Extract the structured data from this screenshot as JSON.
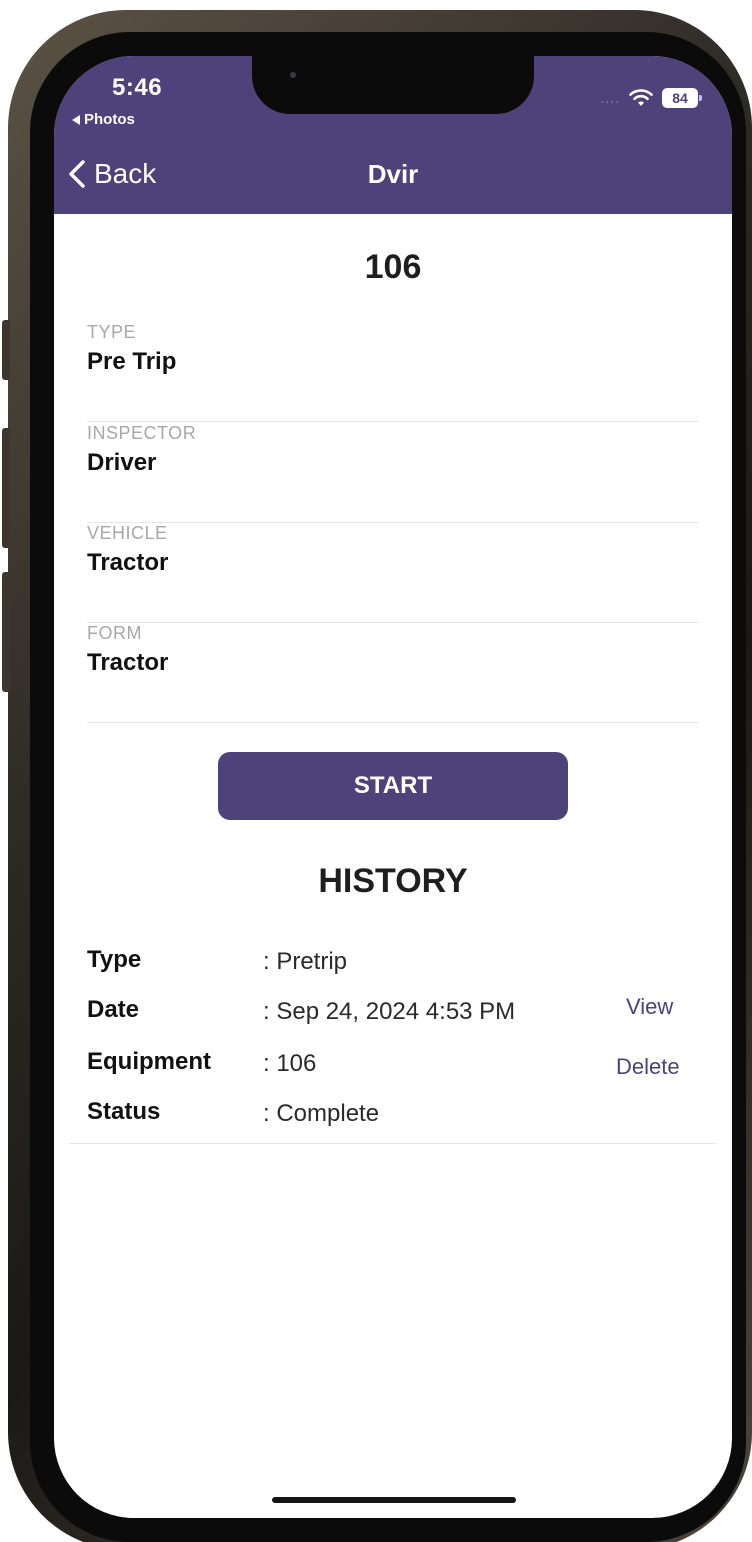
{
  "status_bar": {
    "time": "5:46",
    "back_app": "Photos",
    "battery": "84",
    "cellular_dots": "....",
    "icons": [
      "wifi-icon",
      "battery-icon"
    ]
  },
  "nav": {
    "back_label": "Back",
    "title": "Dvir"
  },
  "record": {
    "title": "106",
    "fields": [
      {
        "label": "TYPE",
        "value": "Pre Trip"
      },
      {
        "label": "INSPECTOR",
        "value": "Driver"
      },
      {
        "label": "VEHICLE",
        "value": "Tractor"
      },
      {
        "label": "FORM",
        "value": "Tractor"
      }
    ]
  },
  "actions": {
    "start_label": "START"
  },
  "history": {
    "title": "HISTORY",
    "items": [
      {
        "rows": [
          {
            "label": "Type",
            "value": ": Pretrip"
          },
          {
            "label": "Date",
            "value": ": Sep 24, 2024 4:53 PM"
          },
          {
            "label": "Equipment",
            "value": ": 106"
          },
          {
            "label": "Status",
            "value": ": Complete"
          }
        ],
        "view_label": "View",
        "delete_label": "Delete"
      }
    ]
  },
  "colors": {
    "brand": "#4d4279",
    "label_gray": "#a8a8a8",
    "divider": "#e6e6e6"
  }
}
